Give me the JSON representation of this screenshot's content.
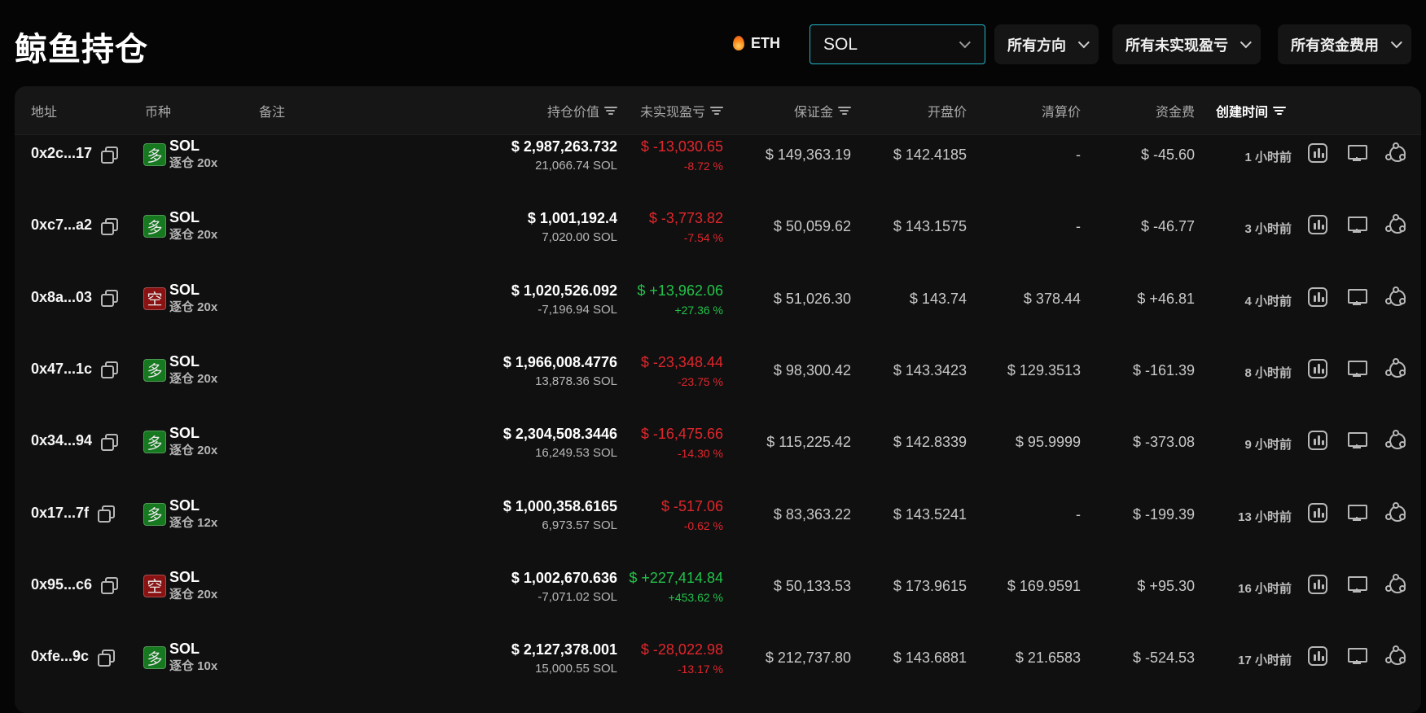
{
  "page": {
    "title": "鲸鱼持仓"
  },
  "filters": {
    "eth_chip": "ETH",
    "symbol": "SOL",
    "direction": "所有方向",
    "pnl": "所有未实现盈亏",
    "funding": "所有资金费用"
  },
  "columns": {
    "address": "地址",
    "coin": "币种",
    "note": "备注",
    "value": "持仓价值",
    "pnl": "未实现盈亏",
    "margin": "保证金",
    "open_price": "开盘价",
    "liq_price": "清算价",
    "funding": "资金费",
    "created": "创建时间"
  },
  "colors": {
    "long": "#16781f",
    "short": "#8a1212",
    "negative": "#e0262c",
    "positive": "#22c24a",
    "accent": "#22b6c9"
  },
  "rows": [
    {
      "address": "0x2c...17",
      "side": "long",
      "side_label": "多",
      "coin": "SOL",
      "mode": "逐仓 20x",
      "value": "$ 2,987,263.732",
      "size": "21,066.74 SOL",
      "pnl": "$ -13,030.65",
      "pnl_pct": "-8.72 %",
      "pnl_sign": "neg",
      "margin": "$ 149,363.19",
      "open_price": "$ 142.4185",
      "liq_price": "-",
      "funding": "$ -45.60",
      "funding_sign": "neg",
      "created": "1 小时前"
    },
    {
      "address": "0xc7...a2",
      "side": "long",
      "side_label": "多",
      "coin": "SOL",
      "mode": "逐仓 20x",
      "value": "$ 1,001,192.4",
      "size": "7,020.00 SOL",
      "pnl": "$ -3,773.82",
      "pnl_pct": "-7.54 %",
      "pnl_sign": "neg",
      "margin": "$ 50,059.62",
      "open_price": "$ 143.1575",
      "liq_price": "-",
      "funding": "$ -46.77",
      "funding_sign": "neg",
      "created": "3 小时前"
    },
    {
      "address": "0x8a...03",
      "side": "short",
      "side_label": "空",
      "coin": "SOL",
      "mode": "逐仓 20x",
      "value": "$ 1,020,526.092",
      "size": "-7,196.94 SOL",
      "pnl": "$ +13,962.06",
      "pnl_pct": "+27.36 %",
      "pnl_sign": "pos",
      "margin": "$ 51,026.30",
      "open_price": "$ 143.74",
      "liq_price": "$ 378.44",
      "funding": "$ +46.81",
      "funding_sign": "pos",
      "created": "4 小时前"
    },
    {
      "address": "0x47...1c",
      "side": "long",
      "side_label": "多",
      "coin": "SOL",
      "mode": "逐仓 20x",
      "value": "$ 1,966,008.4776",
      "size": "13,878.36 SOL",
      "pnl": "$ -23,348.44",
      "pnl_pct": "-23.75 %",
      "pnl_sign": "neg",
      "margin": "$ 98,300.42",
      "open_price": "$ 143.3423",
      "liq_price": "$ 129.3513",
      "funding": "$ -161.39",
      "funding_sign": "neg",
      "created": "8 小时前"
    },
    {
      "address": "0x34...94",
      "side": "long",
      "side_label": "多",
      "coin": "SOL",
      "mode": "逐仓 20x",
      "value": "$ 2,304,508.3446",
      "size": "16,249.53 SOL",
      "pnl": "$ -16,475.66",
      "pnl_pct": "-14.30 %",
      "pnl_sign": "neg",
      "margin": "$ 115,225.42",
      "open_price": "$ 142.8339",
      "liq_price": "$ 95.9999",
      "funding": "$ -373.08",
      "funding_sign": "neg",
      "created": "9 小时前"
    },
    {
      "address": "0x17...7f",
      "side": "long",
      "side_label": "多",
      "coin": "SOL",
      "mode": "逐仓 12x",
      "value": "$ 1,000,358.6165",
      "size": "6,973.57 SOL",
      "pnl": "$ -517.06",
      "pnl_pct": "-0.62 %",
      "pnl_sign": "neg",
      "margin": "$ 83,363.22",
      "open_price": "$ 143.5241",
      "liq_price": "-",
      "funding": "$ -199.39",
      "funding_sign": "neg",
      "created": "13 小时前"
    },
    {
      "address": "0x95...c6",
      "side": "short",
      "side_label": "空",
      "coin": "SOL",
      "mode": "逐仓 20x",
      "value": "$ 1,002,670.636",
      "size": "-7,071.02 SOL",
      "pnl": "$ +227,414.84",
      "pnl_pct": "+453.62 %",
      "pnl_sign": "pos",
      "margin": "$ 50,133.53",
      "open_price": "$ 173.9615",
      "liq_price": "$ 169.9591",
      "funding": "$ +95.30",
      "funding_sign": "pos",
      "created": "16 小时前"
    },
    {
      "address": "0xfe...9c",
      "side": "long",
      "side_label": "多",
      "coin": "SOL",
      "mode": "逐仓 10x",
      "value": "$ 2,127,378.001",
      "size": "15,000.55 SOL",
      "pnl": "$ -28,022.98",
      "pnl_pct": "-13.17 %",
      "pnl_sign": "neg",
      "margin": "$ 212,737.80",
      "open_price": "$ 143.6881",
      "liq_price": "$ 21.6583",
      "funding": "$ -524.53",
      "funding_sign": "neg",
      "created": "17 小时前"
    }
  ]
}
